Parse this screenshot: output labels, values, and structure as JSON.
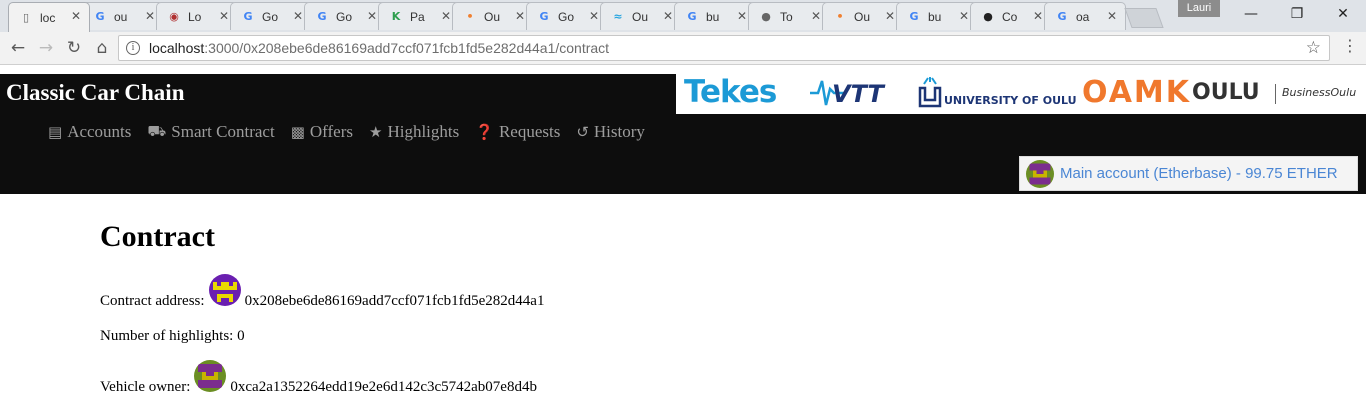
{
  "browser": {
    "tabs": [
      {
        "title": "loc",
        "favicon": "page-icon",
        "color": "#666666",
        "active": true
      },
      {
        "title": "ou",
        "favicon": "google-icon",
        "color": "#4285f4"
      },
      {
        "title": "Lo",
        "favicon": "wikimedia-icon",
        "color": "#b03030"
      },
      {
        "title": "Go",
        "favicon": "google-icon",
        "color": "#4285f4"
      },
      {
        "title": "Go",
        "favicon": "google-icon",
        "color": "#4285f4"
      },
      {
        "title": "Pa",
        "favicon": "kotlin-icon",
        "color": "#2e9e4e"
      },
      {
        "title": "Ou",
        "favicon": "oamk-icon",
        "color": "#f08030"
      },
      {
        "title": "Go",
        "favicon": "google-icon",
        "color": "#4285f4"
      },
      {
        "title": "Ou",
        "favicon": "vtt-icon",
        "color": "#2aa6e0"
      },
      {
        "title": "bu",
        "favicon": "google-icon",
        "color": "#4285f4"
      },
      {
        "title": "To",
        "favicon": "circle-icon",
        "color": "#666666"
      },
      {
        "title": "Ou",
        "favicon": "oamk-icon",
        "color": "#f08030"
      },
      {
        "title": "bu",
        "favicon": "google-icon",
        "color": "#4285f4"
      },
      {
        "title": "Co",
        "favicon": "github-icon",
        "color": "#222222"
      },
      {
        "title": "oa",
        "favicon": "google-icon",
        "color": "#4285f4"
      }
    ],
    "profile_name": "Lauri",
    "url_host": "localhost",
    "url_rest": ":3000/0x208ebe6de86169add7ccf071fcb1fd5e282d44a1/contract"
  },
  "site": {
    "brand": "Classic Car Chain",
    "sponsors": {
      "tekes": "Tekes",
      "vtt": "VTT",
      "university": "UNIVERSITY OF OULU",
      "oamk": "OAMK",
      "oulu": "OULU",
      "business_oulu": "BusinessOulu"
    },
    "nav": [
      {
        "label": "Accounts",
        "icon": "id-card-icon"
      },
      {
        "label": "Smart Contract",
        "icon": "car-icon"
      },
      {
        "label": "Offers",
        "icon": "money-icon"
      },
      {
        "label": "Highlights",
        "icon": "star-icon"
      },
      {
        "label": "Requests",
        "icon": "question-icon"
      },
      {
        "label": "History",
        "icon": "history-icon"
      }
    ],
    "account_button": "Main account (Etherbase) - 99.75 ETHER"
  },
  "page": {
    "title": "Contract",
    "contract_address_label": "Contract address:",
    "contract_address": "0x208ebe6de86169add7ccf071fcb1fd5e282d44a1",
    "highlights_label": "Number of highlights:",
    "highlights_count": "0",
    "owner_label": "Vehicle owner:",
    "owner_address": "0xca2a1352264edd19e2e6d142c3c5742ab07e8d4b"
  },
  "colors": {
    "header_bg": "#0d0d0d",
    "nav_text": "#9d9d9d",
    "account_link": "#4a86d4",
    "tekes_blue": "#1c9ad6",
    "oamk_orange": "#f0782d",
    "oulu_navy": "#1d3575"
  }
}
